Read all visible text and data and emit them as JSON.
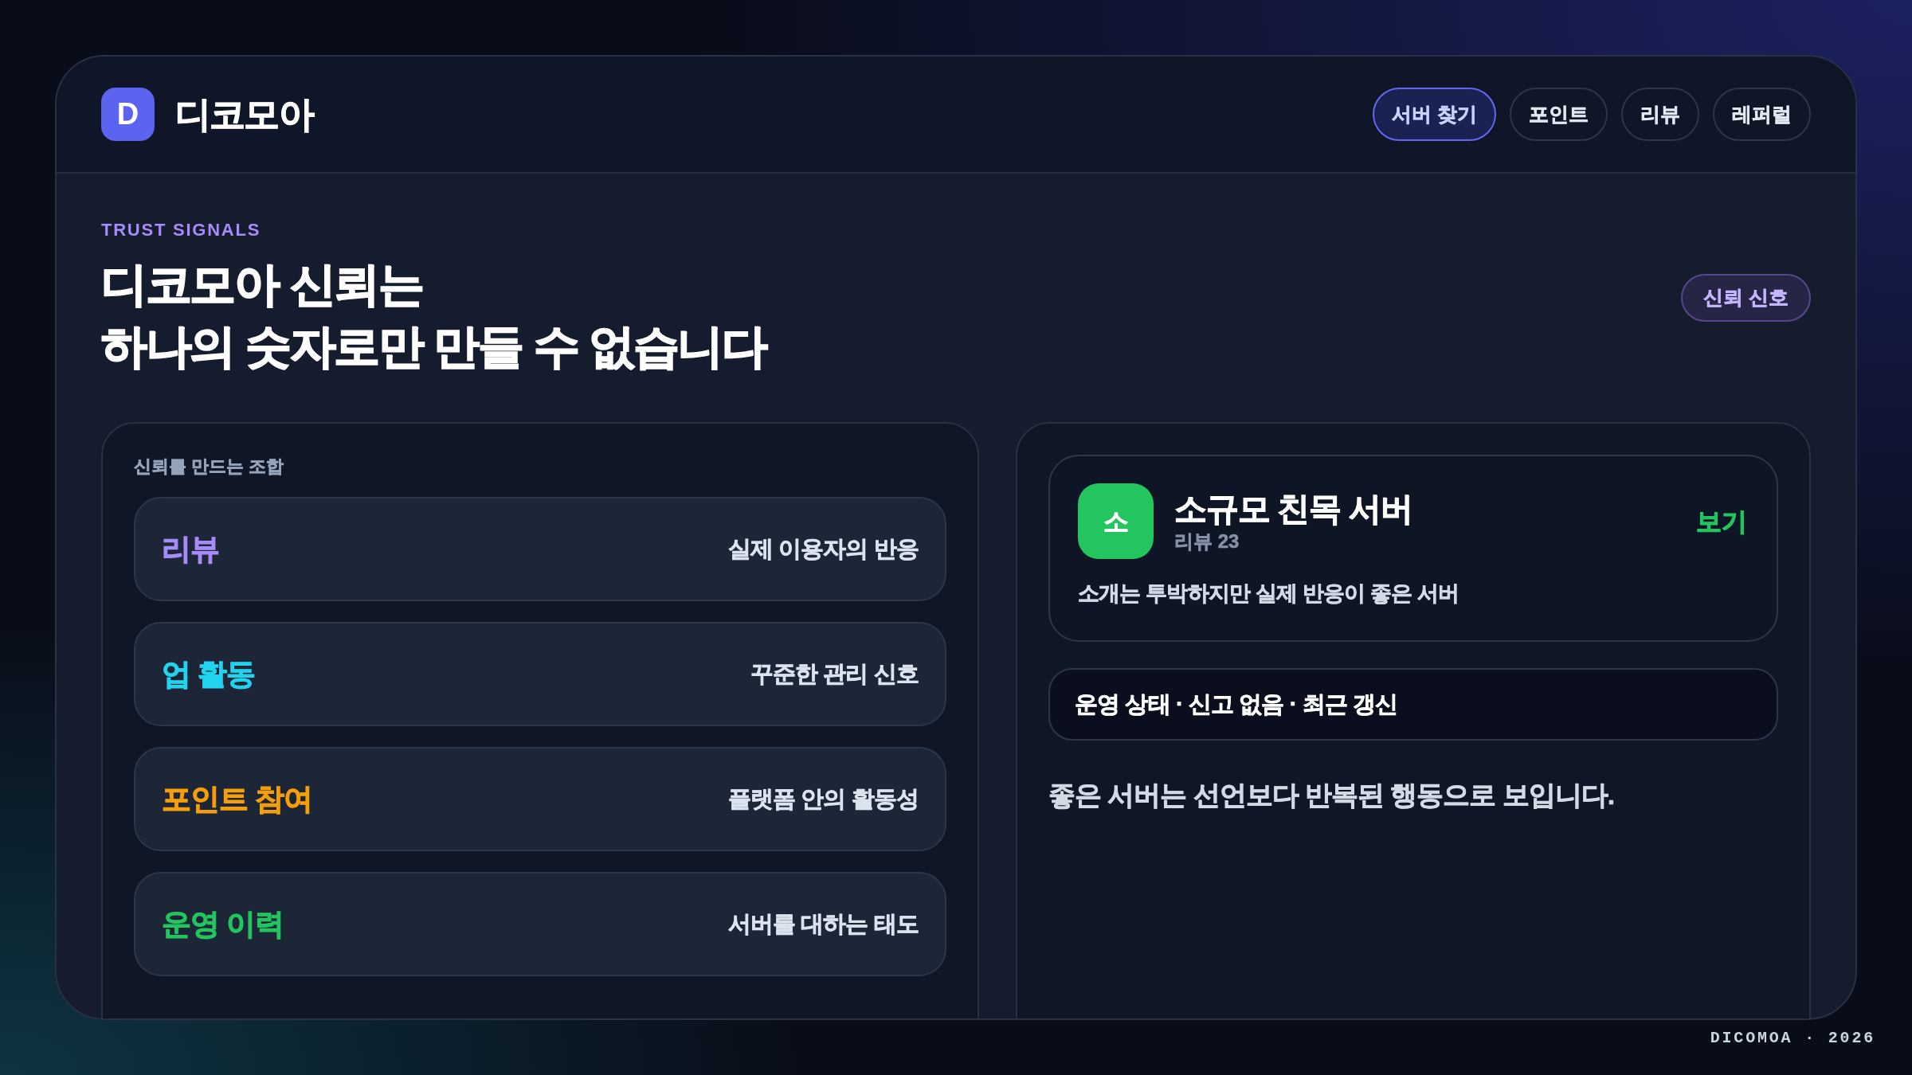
{
  "header": {
    "logo_letter": "D",
    "brand": "디코모아",
    "nav": [
      {
        "label": "서버 찾기",
        "selected": true
      },
      {
        "label": "포인트",
        "selected": false
      },
      {
        "label": "리뷰",
        "selected": false
      },
      {
        "label": "레퍼럴",
        "selected": false
      }
    ]
  },
  "hero": {
    "eyebrow": "TRUST SIGNALS",
    "title_lines": [
      "디코모아 신뢰는",
      "하나의 숫자로만 만들 수 없습니다"
    ],
    "badge": "신뢰 신호"
  },
  "signals_panel": {
    "heading": "신뢰를 만드는 조합",
    "rows": [
      {
        "label": "리뷰",
        "description": "실제 이용자의 반응",
        "color": "#a78bfa"
      },
      {
        "label": "업 활동",
        "description": "꾸준한 관리 신호",
        "color": "#22d3ee"
      },
      {
        "label": "포인트 참여",
        "description": "플랫폼 안의 활동성",
        "color": "#f59e0b"
      },
      {
        "label": "운영 이력",
        "description": "서버를 대하는 태도",
        "color": "#22c55e"
      }
    ]
  },
  "server_panel": {
    "server_card": {
      "avatar_letter": "소",
      "name": "소규모 친목 서버",
      "meta": "리뷰 23",
      "action": "보기",
      "description": "소개는 투박하지만 실제 반응이 좋은 서버"
    },
    "status_line": "운영 상태 · 신고 없음 · 최근 갱신",
    "note": "좋은 서버는 선언보다 반복된 행동으로 보입니다."
  },
  "footer": {
    "text": "DICOMOA · 2026"
  }
}
